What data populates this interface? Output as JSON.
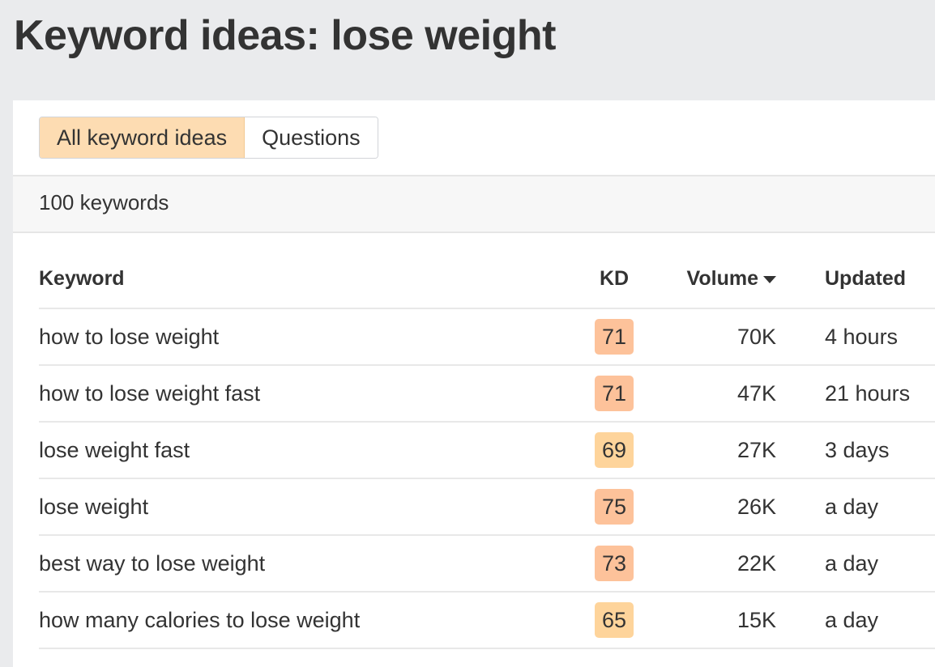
{
  "page": {
    "title": "Keyword ideas: lose weight"
  },
  "tabs": [
    {
      "label": "All keyword ideas",
      "active": true
    },
    {
      "label": "Questions",
      "active": false
    }
  ],
  "summary": {
    "count_label": "100 keywords"
  },
  "table": {
    "columns": {
      "keyword": "Keyword",
      "kd": "KD",
      "volume": "Volume",
      "updated": "Updated"
    },
    "sort": {
      "column": "volume",
      "direction": "desc",
      "icon": "caret-down-icon"
    },
    "rows": [
      {
        "keyword": "how to lose weight",
        "kd": "71",
        "kd_color": "#fdc29a",
        "volume": "70K",
        "updated": "4 hours"
      },
      {
        "keyword": "how to lose weight fast",
        "kd": "71",
        "kd_color": "#fdc29a",
        "volume": "47K",
        "updated": "21 hours"
      },
      {
        "keyword": "lose weight fast",
        "kd": "69",
        "kd_color": "#fed49b",
        "volume": "27K",
        "updated": "3 days"
      },
      {
        "keyword": "lose weight",
        "kd": "75",
        "kd_color": "#fdc29a",
        "volume": "26K",
        "updated": "a day"
      },
      {
        "keyword": "best way to lose weight",
        "kd": "73",
        "kd_color": "#fdc29a",
        "volume": "22K",
        "updated": "a day"
      },
      {
        "keyword": "how many calories to lose weight",
        "kd": "65",
        "kd_color": "#fed49b",
        "volume": "15K",
        "updated": "a day"
      }
    ]
  }
}
